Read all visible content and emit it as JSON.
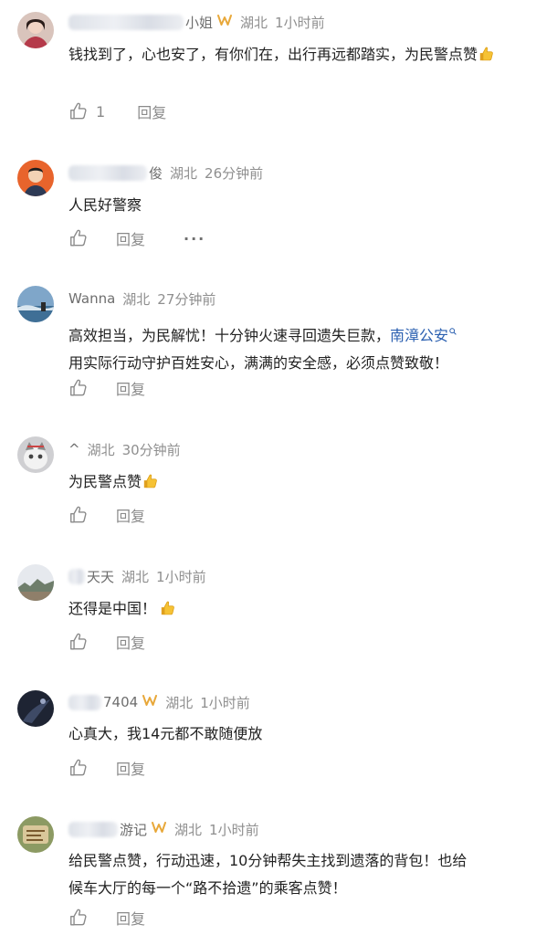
{
  "comments": [
    {
      "username": "小姐",
      "vip_badge": true,
      "location": "湖北",
      "time": "1小时前",
      "text": "钱找到了，心也安了，有你们在，出行再远都踏实，为民警点赞",
      "emoji": "thumbs-up",
      "likes": "1",
      "reply": "回复"
    },
    {
      "username": "俊",
      "vip_badge": false,
      "location": "湖北",
      "time": "26分钟前",
      "text": "人民好警察",
      "likes": "",
      "reply": "回复",
      "more": "···"
    },
    {
      "username": "Wanna",
      "vip_badge": false,
      "location": "湖北",
      "time": "27分钟前",
      "text_line1": "高效担当，为民解忧！十分钟火速寻回遗失巨款，",
      "topic": "南漳公安",
      "text_line2": "用实际行动守护百姓安心，满满的安全感，必须点赞致敬！",
      "likes": "",
      "reply": "回复"
    },
    {
      "username": "^",
      "vip_badge": false,
      "location": "湖北",
      "time": "30分钟前",
      "text": "为民警点赞",
      "emoji": "thumbs-up",
      "likes": "",
      "reply": "回复"
    },
    {
      "username": "天天",
      "vip_badge": false,
      "location": "湖北",
      "time": "1小时前",
      "text": "还得是中国！",
      "emoji": "thumbs-up",
      "likes": "",
      "reply": "回复"
    },
    {
      "username": "7404",
      "vip_badge": true,
      "location": "湖北",
      "time": "1小时前",
      "text": "心真大，我14元都不敢随便放",
      "likes": "",
      "reply": "回复"
    },
    {
      "username": "游记",
      "vip_badge": true,
      "location": "湖北",
      "time": "1小时前",
      "text_line1": "给民警点赞，行动迅速，10分钟帮失主找到遗落的背包！也给",
      "text_line2": "候车大厅的每一个“路不拾遗”的乘客点赞！",
      "likes": "",
      "reply": "回复"
    }
  ],
  "colors": {
    "accent_blue": "#2a5fb0",
    "vip_gold": "#e8a83a",
    "meta_gray": "#8f8f8f"
  }
}
